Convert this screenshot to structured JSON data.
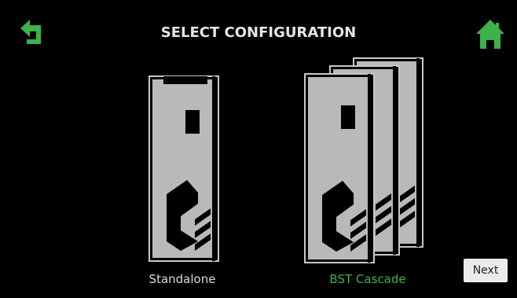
{
  "header": {
    "title": "SELECT CONFIGURATION",
    "back_icon": "back-arrow-icon",
    "home_icon": "home-icon"
  },
  "options": [
    {
      "label": "Standalone",
      "icon": "standalone-unit-icon",
      "selected": false
    },
    {
      "label": "BST Cascade",
      "icon": "cascade-units-icon",
      "selected": true
    }
  ],
  "footer": {
    "next_label": "Next"
  },
  "colors": {
    "accent": "#3db24a",
    "background": "#000000",
    "unit_fill": "#b9b9b9"
  }
}
